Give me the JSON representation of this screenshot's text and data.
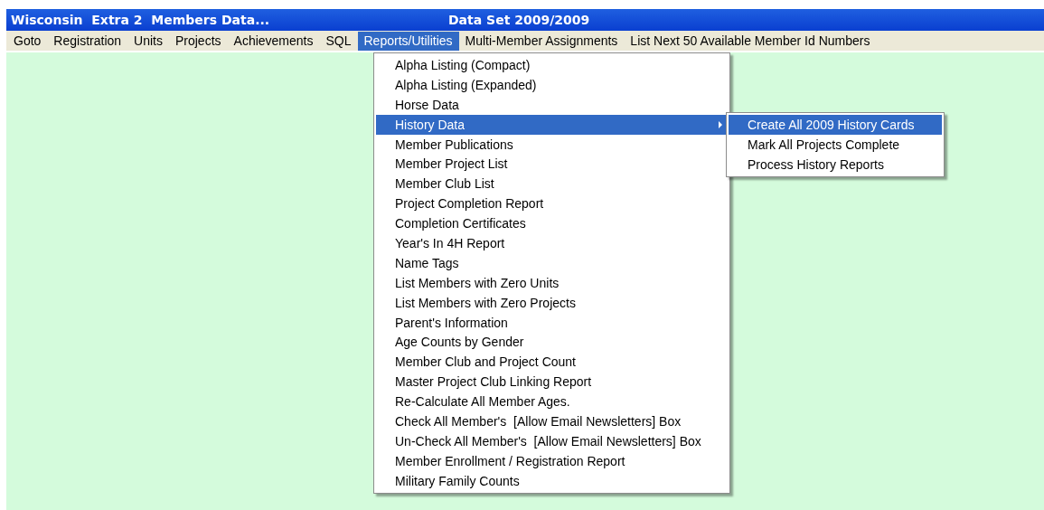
{
  "window": {
    "title": "Wisconsin  Extra 2  Members Data...",
    "subtitle": "Data Set 2009/2009"
  },
  "menu_bar": [
    {
      "label": "Goto",
      "selected": false
    },
    {
      "label": "Registration",
      "selected": false
    },
    {
      "label": "Units",
      "selected": false
    },
    {
      "label": "Projects",
      "selected": false
    },
    {
      "label": "Achievements",
      "selected": false
    },
    {
      "label": "SQL",
      "selected": false
    },
    {
      "label": "Reports/Utilities",
      "selected": true
    },
    {
      "label": "Multi-Member Assignments",
      "selected": false
    },
    {
      "label": "List Next 50 Available Member Id Numbers",
      "selected": false
    }
  ],
  "dropdown": {
    "items": [
      {
        "label": "Alpha Listing (Compact)",
        "selected": false,
        "has_submenu": false
      },
      {
        "label": "Alpha Listing (Expanded)",
        "selected": false,
        "has_submenu": false
      },
      {
        "label": "Horse Data",
        "selected": false,
        "has_submenu": false
      },
      {
        "label": "History Data",
        "selected": true,
        "has_submenu": true
      },
      {
        "label": "Member Publications",
        "selected": false,
        "has_submenu": false
      },
      {
        "label": "Member Project List",
        "selected": false,
        "has_submenu": false
      },
      {
        "label": "Member Club List",
        "selected": false,
        "has_submenu": false
      },
      {
        "label": "Project Completion Report",
        "selected": false,
        "has_submenu": false
      },
      {
        "label": "Completion Certificates",
        "selected": false,
        "has_submenu": false
      },
      {
        "label": "Year's In 4H Report",
        "selected": false,
        "has_submenu": false
      },
      {
        "label": "Name Tags",
        "selected": false,
        "has_submenu": false
      },
      {
        "label": "List Members with Zero Units",
        "selected": false,
        "has_submenu": false
      },
      {
        "label": "List Members with Zero Projects",
        "selected": false,
        "has_submenu": false
      },
      {
        "label": "Parent's Information",
        "selected": false,
        "has_submenu": false
      },
      {
        "label": "Age Counts by Gender",
        "selected": false,
        "has_submenu": false
      },
      {
        "label": "Member Club and Project Count",
        "selected": false,
        "has_submenu": false
      },
      {
        "label": "Master Project Club Linking Report",
        "selected": false,
        "has_submenu": false
      },
      {
        "label": "Re-Calculate All Member Ages.",
        "selected": false,
        "has_submenu": false
      },
      {
        "label": "Check All Member's  [Allow Email Newsletters] Box",
        "selected": false,
        "has_submenu": false
      },
      {
        "label": "Un-Check All Member's  [Allow Email Newsletters] Box",
        "selected": false,
        "has_submenu": false
      },
      {
        "label": "Member Enrollment / Registration Report",
        "selected": false,
        "has_submenu": false
      },
      {
        "label": "Military Family Counts",
        "selected": false,
        "has_submenu": false
      }
    ]
  },
  "submenu": {
    "items": [
      {
        "label": "Create All 2009 History Cards",
        "selected": true
      },
      {
        "label": "Mark All Projects Complete",
        "selected": false
      },
      {
        "label": "Process History Reports",
        "selected": false
      }
    ]
  }
}
